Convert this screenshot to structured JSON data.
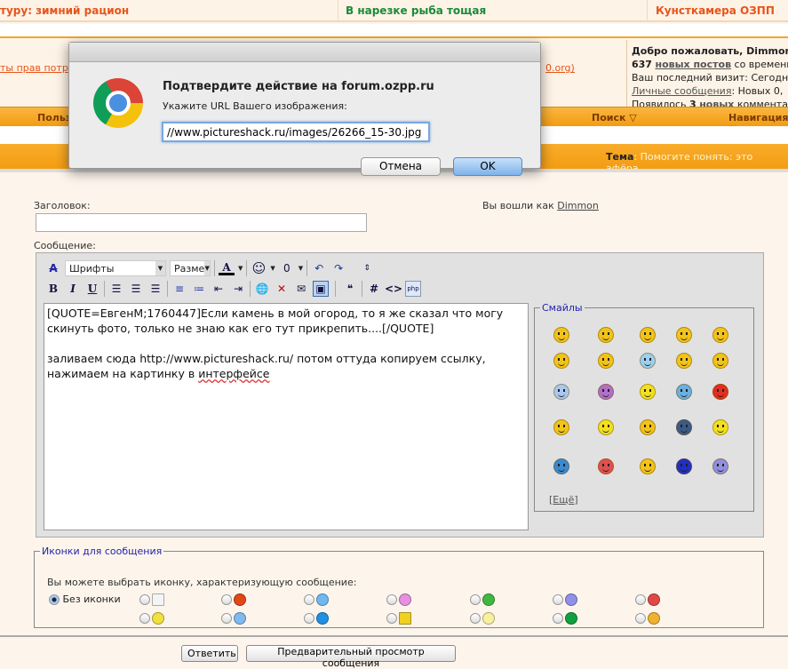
{
  "top_links": [
    {
      "text": "туру: зимний рацион",
      "color": "#e8541a"
    },
    {
      "text": "В нарезке рыба тощая",
      "color": "#1a8a3a"
    },
    {
      "text": "Кунсткамера ОЗПП",
      "color": "#e8541a"
    }
  ],
  "info": {
    "left_link": "ты прав потр",
    "right_link": "0.org)"
  },
  "welcome": {
    "line1_prefix": "Добро пожаловать, ",
    "user": "Dimmon",
    "new_posts_count": "637",
    "new_posts_link": "новых постов",
    "new_posts_suffix": " со времени",
    "last_visit": "Ваш последний визит: Сегодня",
    "pm_link": "Личные сообщения",
    "pm_text": ": Новых 0,",
    "comments_prefix": "Появилось ",
    "comments_count": "3",
    "comments_link": "новых",
    "comments_suffix": " комментариев"
  },
  "nav": {
    "users": "Польз",
    "search": "Поиск ▽",
    "navigation": "Навигация ▽"
  },
  "topic": {
    "label": "Тема",
    "value": ": Помогите понять: это афёра"
  },
  "dialog": {
    "title": "Подтвердите действие на forum.ozpp.ru",
    "label": "Укажите URL Вашего изображения:",
    "input_value": "//www.pictureshack.ru/images/26266_15-30.jpg",
    "cancel": "Отмена",
    "ok": "OK"
  },
  "form": {
    "title_label": "Заголовок:",
    "title_value": "",
    "logged_prefix": "Вы вошли как ",
    "logged_user": "Dimmon",
    "message_label": "Сообщение:"
  },
  "toolbar": {
    "font_select": "Шрифты",
    "size_select": "Разме"
  },
  "message": {
    "line1": "[QUOTE=ЕвгенМ;1760447]Если камень в мой огород, то я же сказал что могу скинуть фото, только не знаю как его тут прикрепить....[/QUOTE]",
    "line2_prefix": "заливаем сюда http://www.pictureshack.ru/ потом оттуда копируем ссылку, нажимаем на картинку в ",
    "line2_spell": "интерфейсе"
  },
  "smilies": {
    "legend": "Смайлы",
    "more": "Ещё",
    "items": [
      {
        "name": "angry",
        "color": "#f2c318"
      },
      {
        "name": "tongue",
        "color": "#f2c318"
      },
      {
        "name": "wink",
        "color": "#f2c318"
      },
      {
        "name": "biggrin",
        "color": "#f2c318"
      },
      {
        "name": "eek",
        "color": "#f2c318"
      },
      {
        "name": "smile",
        "color": "#f2c318"
      },
      {
        "name": "confused",
        "color": "#f2c318"
      },
      {
        "name": "cold",
        "color": "#9ccff0"
      },
      {
        "name": "rolleyes",
        "color": "#f2c318"
      },
      {
        "name": "cool",
        "color": "#f2c318"
      },
      {
        "name": "scared",
        "color": "#a8c8f0"
      },
      {
        "name": "laugh",
        "color": "#b070c8"
      },
      {
        "name": "sign",
        "color": "#f2e020"
      },
      {
        "name": "blue",
        "color": "#6ab0e0"
      },
      {
        "name": "heart",
        "color": "#e03020"
      },
      {
        "name": "gun",
        "color": "#f2c318"
      },
      {
        "name": "dance",
        "color": "#f2e020"
      },
      {
        "name": "question",
        "color": "#f2c318"
      },
      {
        "name": "bomb",
        "color": "#3a5a8a"
      },
      {
        "name": "hang",
        "color": "#f2e020"
      },
      {
        "name": "angel",
        "color": "#3a8ad0"
      },
      {
        "name": "red",
        "color": "#e05050"
      },
      {
        "name": "smile2",
        "color": "#f2c318"
      },
      {
        "name": "ninja",
        "color": "#2030c0"
      },
      {
        "name": "grin",
        "color": "#9090e0"
      }
    ]
  },
  "post_icons": {
    "legend": "Иконки для сообщения",
    "hint": "Вы можете выбрать иконку, характеризующую сообщение:",
    "none_label": "Без иконки",
    "selected": "none",
    "items": [
      {
        "name": "note",
        "color": "#f4f4f4"
      },
      {
        "name": "thumbs-down",
        "color": "#e04818"
      },
      {
        "name": "blue-smile",
        "color": "#70b8f0"
      },
      {
        "name": "pink-smile",
        "color": "#e890e0"
      },
      {
        "name": "green-grin",
        "color": "#40b840"
      },
      {
        "name": "purple-sad",
        "color": "#9090e8"
      },
      {
        "name": "red-angry",
        "color": "#e04848"
      },
      {
        "name": "smile",
        "color": "#f0e040"
      },
      {
        "name": "cool",
        "color": "#80b8f0"
      },
      {
        "name": "question",
        "color": "#2090e0"
      },
      {
        "name": "warning",
        "color": "#f0d020"
      },
      {
        "name": "bulb",
        "color": "#f8f0a0"
      },
      {
        "name": "arrow",
        "color": "#10a040"
      },
      {
        "name": "thumbs-up",
        "color": "#f0b030"
      }
    ]
  },
  "buttons": {
    "reply": "Ответить",
    "preview": "Предварительный просмотр сообщения"
  }
}
